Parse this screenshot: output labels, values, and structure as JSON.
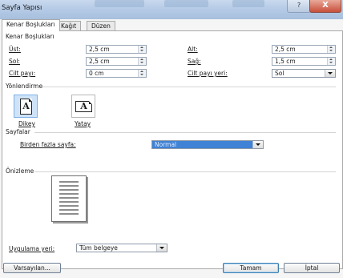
{
  "window": {
    "title": "Sayfa Yapısı",
    "help_glyph": "?",
    "close_glyph": "X"
  },
  "tabs": [
    {
      "label": "Kenar Boşlukları",
      "active": true
    },
    {
      "label": "Kağıt",
      "active": false
    },
    {
      "label": "Düzen",
      "active": false
    }
  ],
  "margins": {
    "section_label": "Kenar Boşlukları",
    "top_label": "Üst:",
    "top_value": "2,5 cm",
    "bottom_label": "Alt:",
    "bottom_value": "2,5 cm",
    "left_label": "Sol:",
    "left_value": "2,5 cm",
    "right_label": "Sağ:",
    "right_value": "1,5 cm",
    "gutter_label": "Cilt payı:",
    "gutter_value": "0 cm",
    "gutter_pos_label": "Cilt payı yeri:",
    "gutter_pos_value": "Sol"
  },
  "orientation": {
    "section_label": "Yönlendirme",
    "portrait_label": "Dikey",
    "landscape_label": "Yatay",
    "glyph": "A",
    "selected": "portrait"
  },
  "pages": {
    "section_label": "Sayfalar",
    "multiple_label": "Birden fazla sayfa:",
    "multiple_value": "Normal"
  },
  "preview": {
    "section_label": "Önizleme"
  },
  "apply": {
    "label": "Uygulama yeri:",
    "value": "Tüm belgeye"
  },
  "buttons": {
    "default_label": "Varsayılan...",
    "ok_label": "Tamam",
    "cancel_label": "İptal"
  },
  "colors": {
    "selection": "#3f82d6",
    "titlebar": "#b6cbe6",
    "close": "#c8503a"
  }
}
